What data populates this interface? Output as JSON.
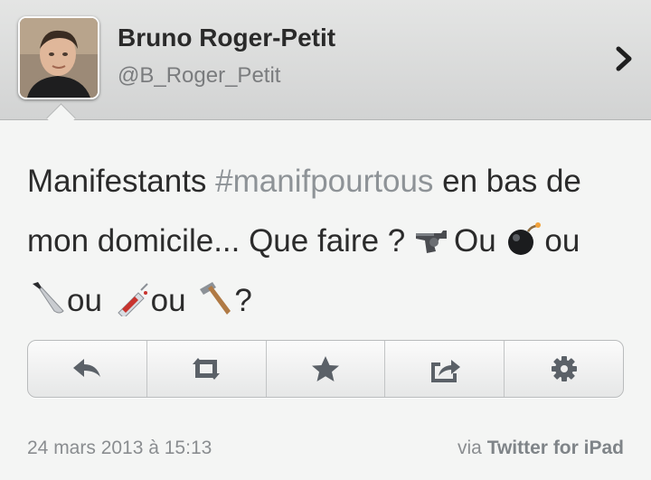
{
  "profile": {
    "name": "Bruno Roger-Petit",
    "handle": "@B_Roger_Petit"
  },
  "tweet": {
    "text_1": "Manifestants ",
    "hashtag": "#manifpourtous",
    "text_2": " en bas de mon domicile... Que faire ? ",
    "word_1": "Ou ",
    "word_2": "ou ",
    "word_3": "ou ",
    "word_4": "ou ",
    "end": "?",
    "emoji": [
      "pistol-icon",
      "bomb-icon",
      "knife-icon",
      "syringe-icon",
      "hammer-icon"
    ]
  },
  "actions": [
    {
      "name": "reply-icon"
    },
    {
      "name": "retweet-icon"
    },
    {
      "name": "favorite-star-icon"
    },
    {
      "name": "share-icon"
    },
    {
      "name": "settings-gear-icon"
    }
  ],
  "footer": {
    "timestamp": "24 mars 2013 à 15:13",
    "via_prefix": "via ",
    "via_app": "Twitter for iPad"
  },
  "colors": {
    "header_bg": "#d9dada",
    "text": "#2b2b2b",
    "hashtag": "#8e9397",
    "icon": "#5b6168"
  }
}
